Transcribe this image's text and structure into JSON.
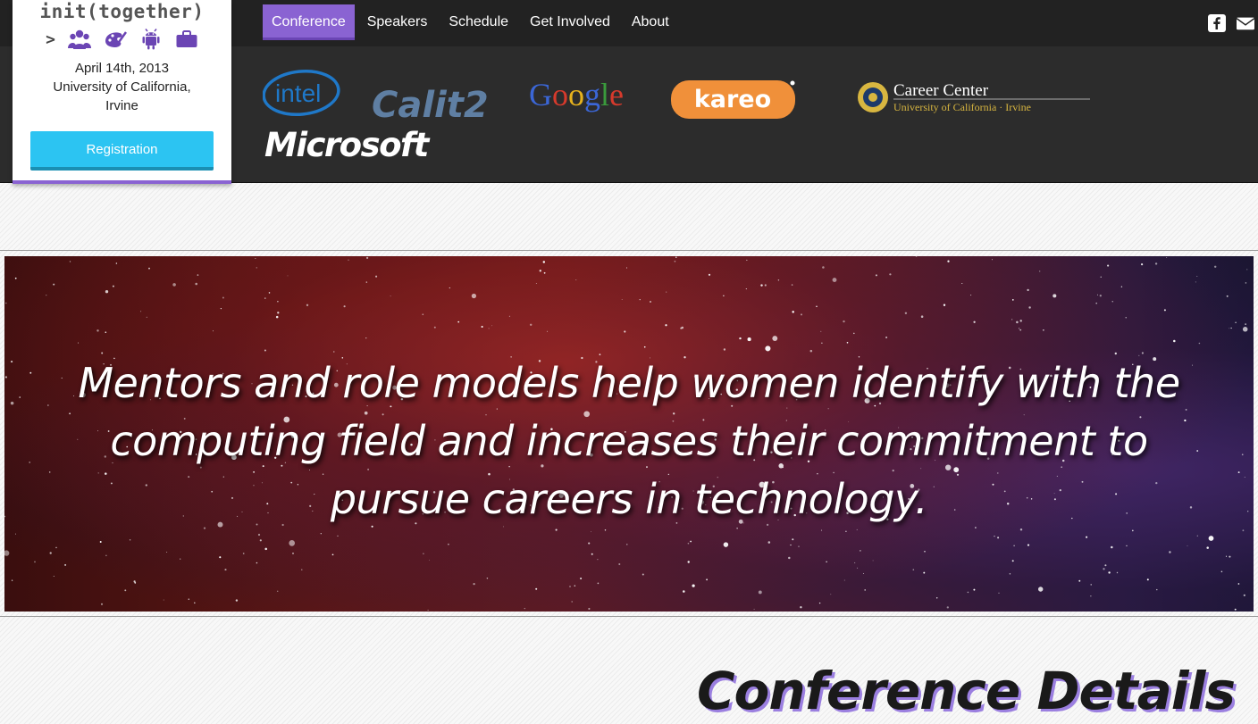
{
  "nav": {
    "items": [
      {
        "label": "Conference",
        "active": true
      },
      {
        "label": "Speakers",
        "active": false
      },
      {
        "label": "Schedule",
        "active": false
      },
      {
        "label": "Get Involved",
        "active": false
      },
      {
        "label": "About",
        "active": false
      }
    ],
    "social_icons": [
      "facebook-icon",
      "envelope-icon"
    ],
    "active_color": "#8a63d2"
  },
  "card": {
    "brand": "init(together)",
    "prompt": ">",
    "icons": [
      "people-icon",
      "palette-icon",
      "android-icon",
      "briefcase-icon"
    ],
    "date": "April 14th, 2013",
    "place_line1": "University of California,",
    "place_line2": "Irvine",
    "register_label": "Registration",
    "register_color": "#2cc4f2"
  },
  "sponsors": {
    "intel": "intel",
    "calit2": "Calit2",
    "google": "Google",
    "kareo": "kareo",
    "career_title": "Career Center",
    "career_sub": "University of California · Irvine",
    "microsoft": "Microsoft"
  },
  "hero": {
    "quote": "Mentors and role models help women identify with the computing field and increases their commitment to pursue careers in technology."
  },
  "section": {
    "title": "Conference Details"
  }
}
